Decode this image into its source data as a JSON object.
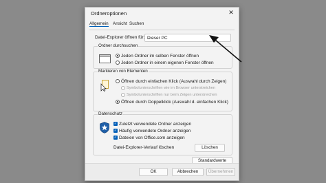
{
  "dialog": {
    "title": "Ordneroptionen",
    "close_glyph": "✕",
    "tabs": [
      {
        "label": "Allgemein"
      },
      {
        "label": "Ansicht"
      },
      {
        "label": "Suchen"
      }
    ],
    "open_with_label": "Datei-Explorer öffnen für:",
    "open_with_value": "Dieser PC",
    "browse": {
      "title": "Ordner durchsuchen",
      "options": [
        "Jeden Ordner im selben Fenster öffnen",
        "Jeden Ordner in einem eigenen Fenster öffnen"
      ]
    },
    "click": {
      "title": "Markieren von Elementen",
      "single": "Öffnen durch einfachen Klick (Auswahl durch Zeigen)",
      "sub1": "Symbolunterschriften wie im Browser unterstreichen",
      "sub2": "Symbolunterschriften nur beim Zeigen unterstreichen",
      "double": "Öffnen durch Doppelklick (Auswahl d. einfachen Klick)"
    },
    "privacy": {
      "title": "Datenschutz",
      "checks": [
        "Zuletzt verwendete Ordner anzeigen",
        "Häufig verwendete Ordner anzeigen",
        "Dateien von Office.com anzeigen"
      ],
      "history_label": "Datei-Explorer-Verlauf löschen",
      "clear_button": "Löschen"
    },
    "defaults_button": "Standardwerte",
    "ok_button": "OK",
    "cancel_button": "Abbrechen",
    "apply_button": "Übernehmen"
  },
  "colors": {
    "accent": "#005fb8",
    "backdrop": "#8a8a8a"
  }
}
